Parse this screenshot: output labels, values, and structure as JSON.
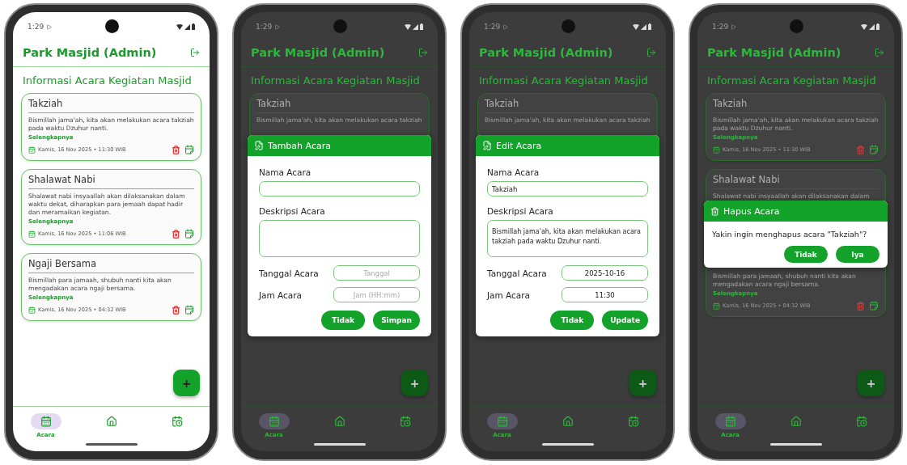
{
  "phones": [
    {
      "status_time": "1:29",
      "app_title": "Park Masjid (Admin)",
      "heading": "Informasi Acara Kegiatan Masjid",
      "dimmed": false,
      "cards": [
        {
          "title": "Takziah",
          "description": "Bismillah jama'ah, kita akan melakukan acara takziah pada waktu Dzuhur nanti.",
          "more": "Selengkapnya",
          "date": "Kamis, 16 Nov 2025 • 11:30 WIB"
        },
        {
          "title": "Shalawat Nabi",
          "description": "Shalawat nabi insyaallah akan dilaksanakan dalam waktu dekat, diharapkan para jemaah dapat hadir dan meramaikan kegiatan.",
          "more": "Selengkapnya",
          "date": "Kamis, 16 Nov 2025 • 11:06 WIB"
        },
        {
          "title": "Ngaji Bersama",
          "description": "Bismillah para jamaah, shubuh nanti kita akan mengadakan acara ngaji bersama.",
          "more": "Selengkapnya",
          "date": "Kamis, 16 Nov 2025 • 04:32 WIB"
        }
      ],
      "fab": "+",
      "nav": [
        {
          "kind": "calendar",
          "label": "Acara",
          "selected": true
        },
        {
          "kind": "home",
          "selected": false
        },
        {
          "kind": "schedule",
          "selected": false
        }
      ]
    },
    {
      "status_time": "1:29",
      "app_title": "Park Masjid (Admin)",
      "heading": "Informasi Acara Kegiatan Masjid",
      "dimmed": true,
      "cards": [
        {
          "title": "Takziah",
          "description": "Bismillah jama'ah, kita akan melakukan acara takziah"
        }
      ],
      "fab": "+",
      "nav": [
        {
          "kind": "calendar",
          "label": "Acara",
          "selected": true
        },
        {
          "kind": "home",
          "selected": false
        },
        {
          "kind": "schedule",
          "selected": false
        }
      ],
      "dialog": {
        "kind": "form",
        "title": "Tambah Acara",
        "fields": [
          {
            "kind": "line",
            "label": "Nama Acara"
          },
          {
            "kind": "area",
            "label": "Deskripsi Acara"
          },
          {
            "kind": "inline",
            "label": "Tanggal Acara",
            "placeholder": "Tanggal"
          },
          {
            "kind": "inline",
            "label": "Jam Acara",
            "placeholder": "Jam (HH:mm)"
          }
        ],
        "buttons": [
          "Tidak",
          "Simpan"
        ]
      }
    },
    {
      "status_time": "1:29",
      "app_title": "Park Masjid (Admin)",
      "heading": "Informasi Acara Kegiatan Masjid",
      "dimmed": true,
      "cards": [
        {
          "title": "Takziah",
          "description": "Bismillah jama'ah, kita akan melakukan acara takziah"
        }
      ],
      "fab": "+",
      "nav": [
        {
          "kind": "calendar",
          "label": "Acara",
          "selected": true
        },
        {
          "kind": "home",
          "selected": false
        },
        {
          "kind": "schedule",
          "selected": false
        }
      ],
      "dialog": {
        "kind": "form",
        "title": "Edit Acara",
        "fields": [
          {
            "kind": "line",
            "label": "Nama Acara",
            "value": "Takziah"
          },
          {
            "kind": "area",
            "label": "Deskripsi Acara",
            "value": "Bismillah jama'ah, kita akan melakukan acara takziah pada waktu Dzuhur nanti."
          },
          {
            "kind": "inline",
            "label": "Tanggal Acara",
            "value": "2025-10-16"
          },
          {
            "kind": "inline",
            "label": "Jam Acara",
            "value": "11:30"
          }
        ],
        "buttons": [
          "Tidak",
          "Update"
        ]
      }
    },
    {
      "status_time": "1:29",
      "app_title": "Park Masjid (Admin)",
      "heading": "Informasi Acara Kegiatan Masjid",
      "dimmed": true,
      "cards": [
        {
          "title": "Takziah",
          "description": "Bismillah jama'ah, kita akan melakukan acara takziah pada waktu Dzuhur nanti.",
          "more": "Selengkapnya",
          "date": "Kamis, 16 Nov 2025 • 11:30 WIB"
        },
        {
          "title": "Shalawat Nabi",
          "description": "Shalawat nabi insyaallah akan dilaksanakan dalam"
        },
        {
          "description": "Bismillah para jamaah, shubuh nanti kita akan mengadakan acara ngaji bersama.",
          "more": "Selengkapnya",
          "date": "Kamis, 16 Nov 2025 • 04:32 WIB"
        }
      ],
      "fab": "+",
      "nav": [
        {
          "kind": "calendar",
          "label": "Acara",
          "selected": true
        },
        {
          "kind": "home",
          "selected": false
        },
        {
          "kind": "schedule",
          "selected": false
        }
      ],
      "dialog": {
        "kind": "confirm",
        "title": "Hapus Acara",
        "message": "Yakin ingin menghapus acara \"Takziah\"?",
        "buttons": [
          "Tidak",
          "Iya"
        ]
      }
    }
  ]
}
